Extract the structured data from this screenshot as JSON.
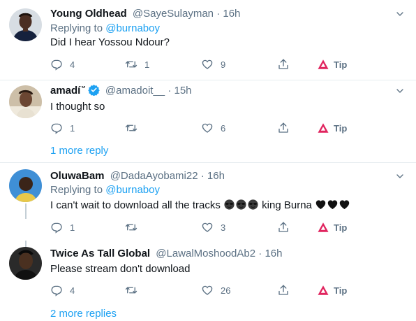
{
  "tweets": [
    {
      "name": "Young Oldhead",
      "handle": "@SayeSulayman",
      "time": "16h",
      "replying_label": "Replying to",
      "replying_to": "@burnaboy",
      "text": "Did I hear Yossou Ndour?",
      "replies": "4",
      "retweets": "1",
      "likes": "9",
      "tip": "Tip"
    },
    {
      "name": "amadí ̈̆",
      "handle": "@amadoit__",
      "time": "15h",
      "text": "I thought so",
      "replies": "1",
      "retweets": "",
      "likes": "6",
      "tip": "Tip",
      "more_replies": "1 more reply"
    },
    {
      "name": "OluwaBam",
      "handle": "@DadaAyobami22",
      "time": "16h",
      "replying_label": "Replying to",
      "replying_to": "@burnaboy",
      "text_before": "I can't wait to download all the tracks",
      "text_middle": "king Burna",
      "replies": "1",
      "retweets": "",
      "likes": "3",
      "tip": "Tip"
    },
    {
      "name": "Twice As Tall Global",
      "handle": "@LawalMoshoodAb2",
      "time": "16h",
      "text": "Please stream don't download",
      "replies": "4",
      "retweets": "",
      "likes": "26",
      "tip": "Tip",
      "more_replies": "2 more replies"
    }
  ],
  "separator": "·",
  "icons": [
    "reply-icon",
    "retweet-icon",
    "like-icon",
    "share-icon",
    "tip-icon",
    "caret-down-icon",
    "verified-icon"
  ],
  "colors": {
    "accent": "#1da1f2",
    "muted": "#5b7083",
    "tip_red": "#e0245e"
  }
}
